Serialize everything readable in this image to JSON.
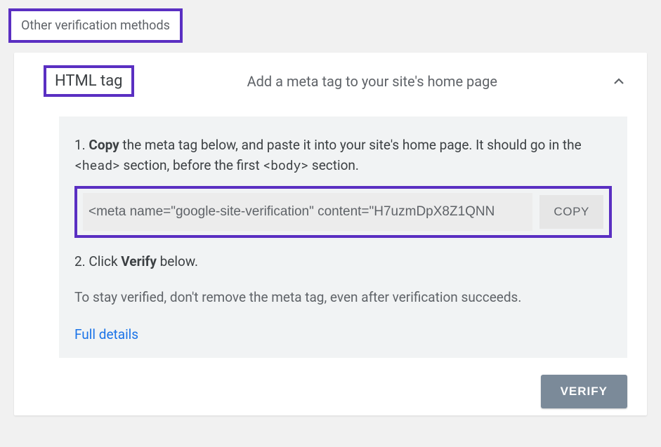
{
  "section": {
    "heading": "Other verification methods"
  },
  "method": {
    "title": "HTML tag",
    "subtitle": "Add a meta tag to your site's home page"
  },
  "step1": {
    "prefix": "1. ",
    "bold": "Copy",
    "mid1": " the meta tag below, and paste it into your site's home page. It should go in the ",
    "head_tag": "<head>",
    "mid2": " section, before the first ",
    "body_tag": "<body>",
    "mid3": " section."
  },
  "meta_code": "<meta name=\"google-site-verification\" content=\"H7uzmDpX8Z1QNN",
  "copy_label": "COPY",
  "step2": {
    "prefix": "2. Click ",
    "bold": "Verify",
    "suffix": " below."
  },
  "stay_text": "To stay verified, don't remove the meta tag, even after verification succeeds.",
  "details_link": "Full details",
  "verify_label": "VERIFY"
}
